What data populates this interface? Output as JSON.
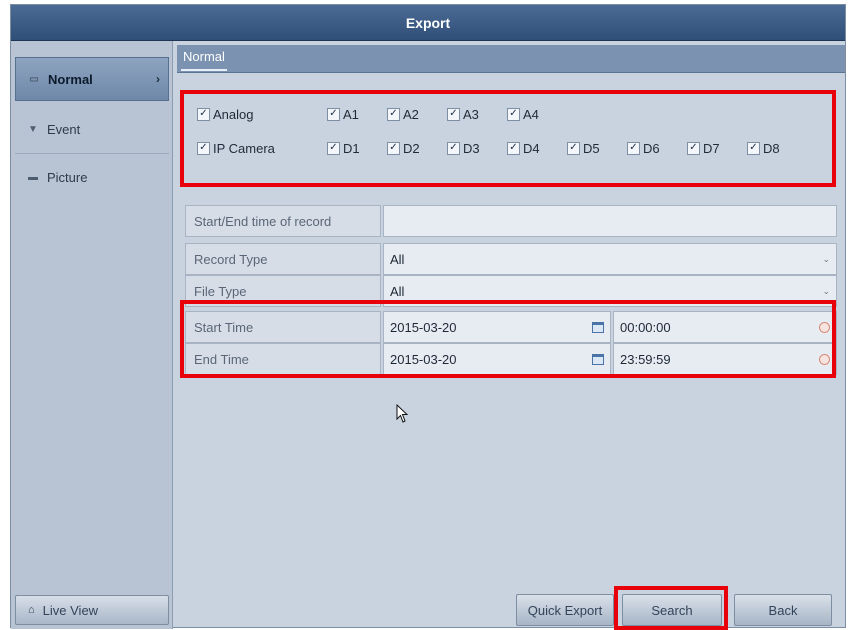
{
  "window": {
    "title": "Export"
  },
  "sidebar": {
    "items": [
      {
        "label": "Normal",
        "icon": "camera-icon"
      },
      {
        "label": "Event",
        "icon": "pin-icon"
      },
      {
        "label": "Picture",
        "icon": "picture-icon"
      }
    ],
    "live_view": "Live View"
  },
  "tabs": {
    "active": "Normal"
  },
  "channels": {
    "analog": {
      "label": "Analog",
      "items": [
        "A1",
        "A2",
        "A3",
        "A4"
      ]
    },
    "ip": {
      "label": "IP Camera",
      "items": [
        "D1",
        "D2",
        "D3",
        "D4",
        "D5",
        "D6",
        "D7",
        "D8"
      ]
    }
  },
  "form": {
    "record_time_label": "Start/End time of record",
    "record_time_value": "",
    "record_type_label": "Record Type",
    "record_type_value": "All",
    "file_type_label": "File Type",
    "file_type_value": "All",
    "start_label": "Start Time",
    "start_date": "2015-03-20",
    "start_time": "00:00:00",
    "end_label": "End Time",
    "end_date": "2015-03-20",
    "end_time": "23:59:59"
  },
  "buttons": {
    "quick_export": "Quick Export",
    "search": "Search",
    "back": "Back"
  },
  "colors": {
    "highlight": "#e8000b",
    "titlebar": "#3a5a84"
  }
}
